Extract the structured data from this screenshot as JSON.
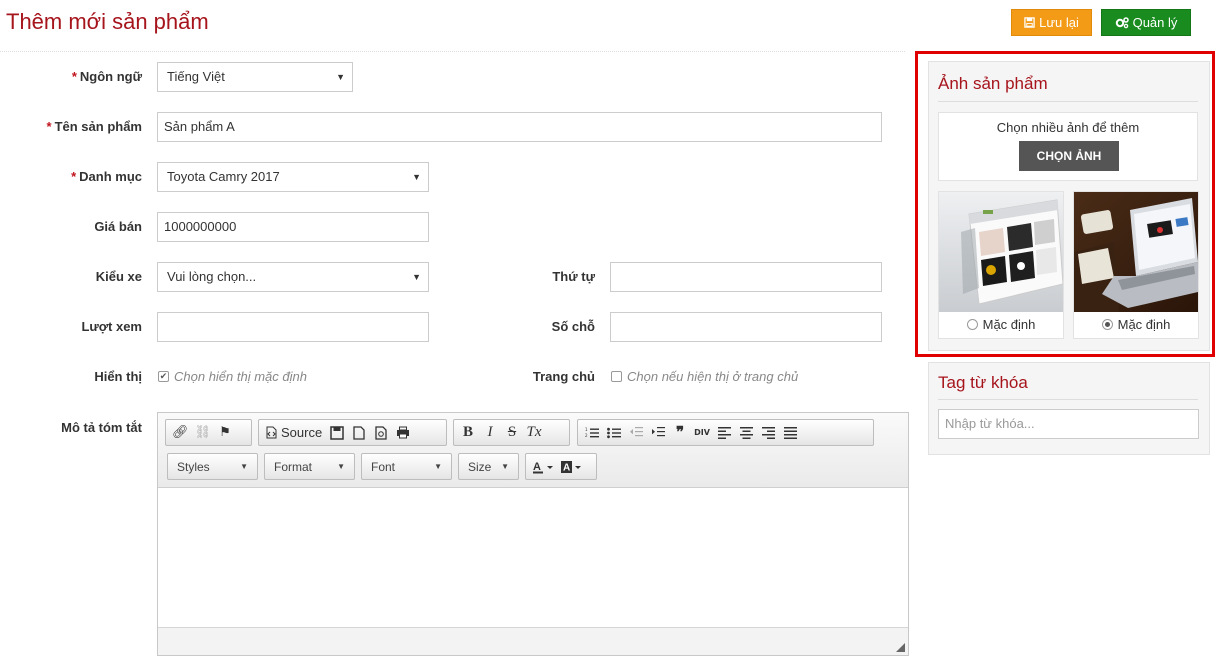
{
  "header": {
    "title": "Thêm mới sản phẩm",
    "save_label": "Lưu lại",
    "manage_label": "Quản lý"
  },
  "form": {
    "language_label": "Ngôn ngữ",
    "language_value": "Tiếng Việt",
    "product_name_label": "Tên sản phẩm",
    "product_name_value": "Sản phẩm A",
    "category_label": "Danh mục",
    "category_value": "Toyota Camry 2017",
    "price_label": "Giá bán",
    "price_value": "1000000000",
    "car_type_label": "Kiểu xe",
    "car_type_value": "Vui lòng chọn...",
    "order_label": "Thứ tự",
    "order_value": "",
    "views_label": "Lượt xem",
    "views_value": "",
    "seats_label": "Số chỗ",
    "seats_value": "",
    "display_label": "Hiển thị",
    "display_checkbox_label": "Chọn hiển thị mặc định",
    "display_checked": true,
    "homepage_label": "Trang chủ",
    "homepage_checkbox_label": "Chọn nếu hiện thị ở trang chủ",
    "homepage_checked": false,
    "summary_label": "Mô tả tóm tắt",
    "required_mark": "*"
  },
  "editor": {
    "source_label": "Source",
    "combos": [
      "Styles",
      "Format",
      "Font",
      "Size"
    ],
    "bold": "B",
    "italic": "I",
    "strike": "S",
    "clear_format": "Tx",
    "quote": "❞",
    "div_label": "DIV"
  },
  "images_panel": {
    "title": "Ảnh sản phẩm",
    "upload_hint": "Chọn nhiều ảnh để thêm",
    "choose_button": "CHỌN ẢNH",
    "images": [
      {
        "option_label": "Mặc định",
        "selected": false
      },
      {
        "option_label": "Mặc định",
        "selected": true
      }
    ]
  },
  "tags_panel": {
    "title": "Tag từ khóa",
    "placeholder": "Nhập từ khóa..."
  },
  "colors": {
    "accent_red": "#a6141c",
    "save_orange": "#f39a16",
    "manage_green": "#1a8c1f",
    "highlight_red": "#e00000"
  }
}
